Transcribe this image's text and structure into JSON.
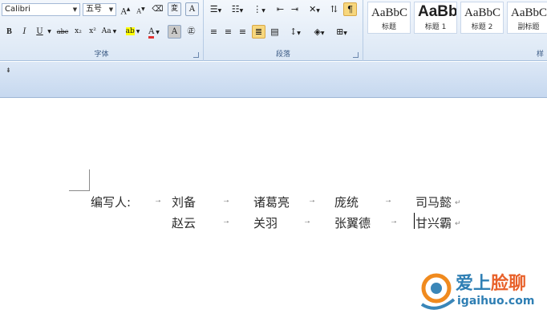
{
  "font_group": {
    "font_name": "Calibri",
    "font_size": "五号",
    "label": "字体",
    "buttons": [
      "A",
      "A",
      "A",
      "B",
      "I",
      "U",
      "abc",
      "x₂",
      "x²",
      "Aa",
      "A",
      "A"
    ]
  },
  "paragraph_group": {
    "label": "段落"
  },
  "styles_group": {
    "label": "样",
    "items": [
      {
        "sample": "AaBbC",
        "name": "标题"
      },
      {
        "sample": "AaBb",
        "name": "标题 1"
      },
      {
        "sample": "AaBbC",
        "name": "标题 2"
      },
      {
        "sample": "AaBbC",
        "name": "副标题"
      }
    ]
  },
  "document": {
    "label": "编写人:",
    "row1": [
      "刘备",
      "诸葛亮",
      "庞统",
      "司马懿"
    ],
    "row2": [
      "赵云",
      "关羽",
      "张翼德",
      "甘兴霸"
    ],
    "tab_mark": "→",
    "para_mark": "↵"
  },
  "watermark": {
    "line1": "爱上",
    "line2": "脸聊",
    "site": "igaihuo.com"
  }
}
